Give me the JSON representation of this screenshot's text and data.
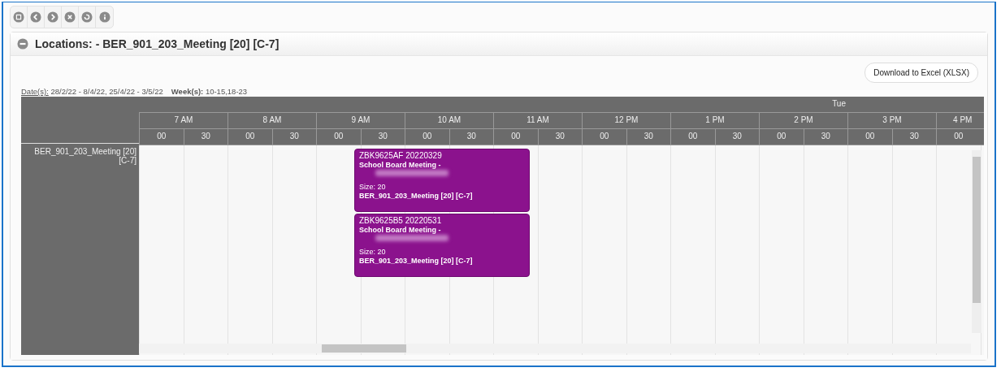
{
  "toolbar": {
    "buttons": [
      {
        "kind": "menu"
      },
      {
        "kind": "back"
      },
      {
        "kind": "forward"
      },
      {
        "kind": "close"
      },
      {
        "kind": "refresh"
      },
      {
        "kind": "info"
      }
    ]
  },
  "panel": {
    "title": "Locations: - BER_901_203_Meeting [20] [C-7]",
    "expanded": true
  },
  "download_button": "Download to Excel (XLSX)",
  "filter": {
    "dates_label": "Date(s):",
    "dates": "28/2/22 - 8/4/22, 25/4/22 - 3/5/22",
    "weeks_label": "Week(s):",
    "weeks": "10-15,18-23"
  },
  "schedule": {
    "day": "Tue",
    "hours": [
      {
        "label": "7 AM",
        "minutes": [
          "00",
          "30"
        ]
      },
      {
        "label": "8 AM",
        "minutes": [
          "00",
          "30"
        ]
      },
      {
        "label": "9 AM",
        "minutes": [
          "00",
          "30"
        ]
      },
      {
        "label": "10 AM",
        "minutes": [
          "00",
          "30"
        ]
      },
      {
        "label": "11 AM",
        "minutes": [
          "00",
          "30"
        ]
      },
      {
        "label": "12 PM",
        "minutes": [
          "00",
          "30"
        ]
      },
      {
        "label": "1 PM",
        "minutes": [
          "00",
          "30"
        ]
      },
      {
        "label": "2 PM",
        "minutes": [
          "00",
          "30"
        ]
      },
      {
        "label": "3 PM",
        "minutes": [
          "00",
          "30"
        ]
      },
      {
        "label": "4 PM",
        "minutes": [
          "00"
        ]
      }
    ],
    "room": "BER_901_203_Meeting [20] [C-7]",
    "events": [
      {
        "code": "ZBK9625AF 20220329",
        "title": "School Board Meeting -",
        "size": "Size: 20",
        "location": "BER_901_203_Meeting [20] [C-7]"
      },
      {
        "code": "ZBK9625B5 20220531",
        "title": "School Board Meeting -",
        "size": "Size: 20",
        "location": "BER_901_203_Meeting [20] [C-7]"
      }
    ]
  }
}
